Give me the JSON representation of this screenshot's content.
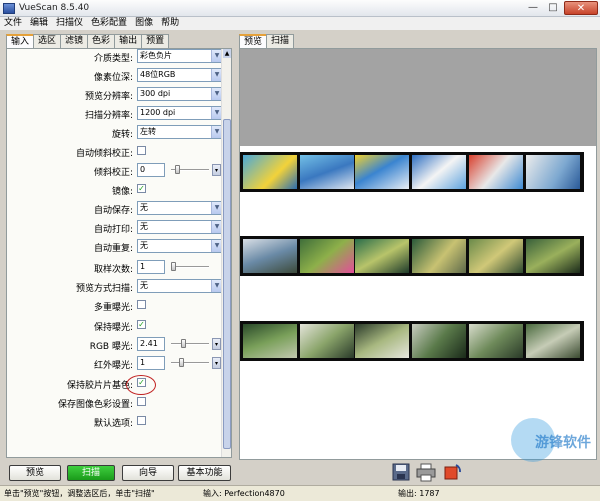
{
  "window": {
    "title": "VueScan 8.5.40"
  },
  "menu": [
    "文件",
    "编辑",
    "扫描仪",
    "色彩配置",
    "图像",
    "帮助"
  ],
  "left_tabs": [
    "输入",
    "选区",
    "滤镜",
    "色彩",
    "输出",
    "预置"
  ],
  "left_active_tab": "输入",
  "settings": [
    {
      "label": "介质类型:",
      "type": "select",
      "value": "彩色负片"
    },
    {
      "label": "像素位深:",
      "type": "select",
      "value": "48位RGB"
    },
    {
      "label": "预览分辨率:",
      "type": "select",
      "value": "300 dpi"
    },
    {
      "label": "扫描分辨率:",
      "type": "select",
      "value": "1200 dpi"
    },
    {
      "label": "旋转:",
      "type": "select",
      "value": "左转"
    },
    {
      "label": "自动倾斜校正:",
      "type": "checkbox",
      "checked": false
    },
    {
      "label": "倾斜校正:",
      "type": "number-slider",
      "value": "0"
    },
    {
      "label": "镜像:",
      "type": "checkbox",
      "checked": true
    },
    {
      "label": "自动保存:",
      "type": "select",
      "value": "无"
    },
    {
      "label": "自动打印:",
      "type": "select",
      "value": "无"
    },
    {
      "label": "自动重复:",
      "type": "select",
      "value": "无"
    },
    {
      "label": "取样次数:",
      "type": "number-slider",
      "value": "1"
    },
    {
      "label": "预览方式扫描:",
      "type": "select",
      "value": "无"
    },
    {
      "label": "多重曝光:",
      "type": "checkbox",
      "checked": false
    },
    {
      "label": "保持曝光:",
      "type": "checkbox",
      "checked": true
    },
    {
      "label": "RGB 曝光:",
      "type": "number-slider",
      "value": "2.41"
    },
    {
      "label": "红外曝光:",
      "type": "number-slider",
      "value": "1"
    },
    {
      "label": "保持胶片片基色:",
      "type": "checkbox",
      "checked": true
    },
    {
      "label": "保存图像色彩设置:",
      "type": "checkbox",
      "checked": false
    },
    {
      "label": "默认选项:",
      "type": "checkbox",
      "checked": false
    }
  ],
  "buttons": {
    "preview": "预览",
    "scan": "扫描",
    "wizard": "向导",
    "basic": "基本功能"
  },
  "right_tabs": [
    "预览",
    "扫描"
  ],
  "right_active_tab": "预览",
  "status": {
    "hint": "单击\"预览\"按钮，调整选区后，单击\"扫描\"",
    "input": "输入: Perfection4870",
    "output": "输出: 1787"
  },
  "watermark": "游锋软件",
  "colors": {
    "scan_button": "#1f9f1f",
    "tab_accent": "#e5a13a",
    "annotation_ellipse": "#c02020"
  },
  "icons": [
    "save-icon",
    "print-icon",
    "rotate-icon"
  ]
}
